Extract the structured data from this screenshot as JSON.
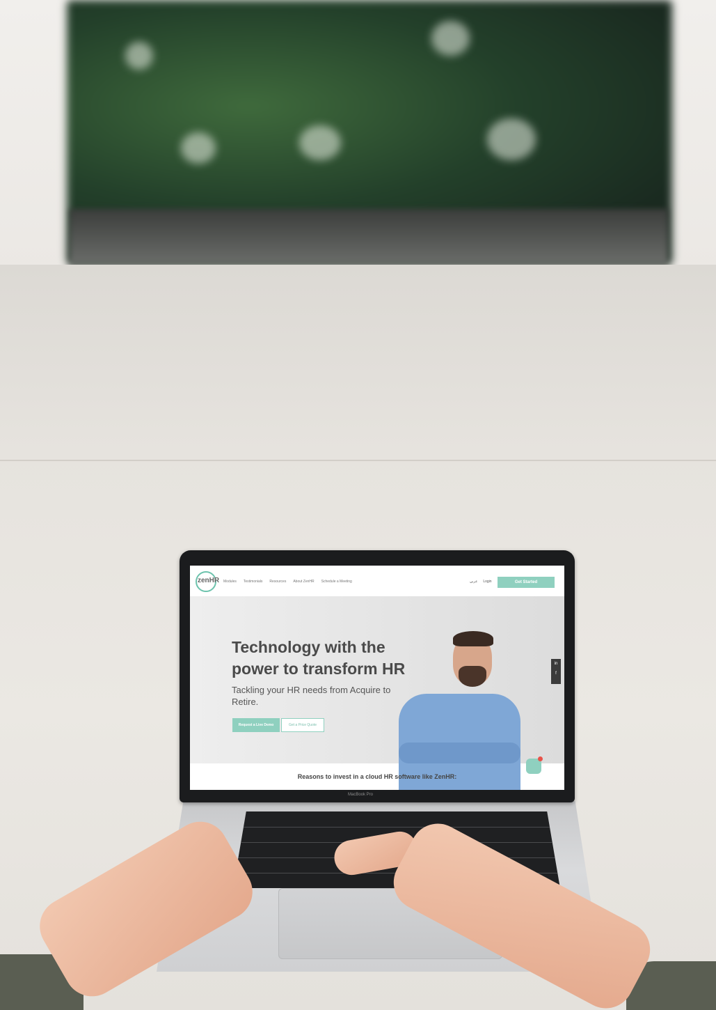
{
  "website": {
    "logo": "zenHR",
    "nav_links": [
      "Modules",
      "Testimonials",
      "Resources",
      "About ZenHR",
      "Schedule a Meeting"
    ],
    "nav_right": [
      "عربي",
      "Login"
    ],
    "cta": "Get Started",
    "hero_title": "Technology with the power to transform HR",
    "hero_subtitle": "Tackling your HR needs from Acquire to Retire.",
    "button_demo": "Request a Live Demo",
    "button_quote": "Get a Price Quote",
    "social": [
      "in",
      "f"
    ],
    "reasons": "Reasons to invest in a cloud HR software like ZenHR:",
    "accent_color": "#8fd0bf"
  },
  "laptop_label": "MacBook Pro"
}
